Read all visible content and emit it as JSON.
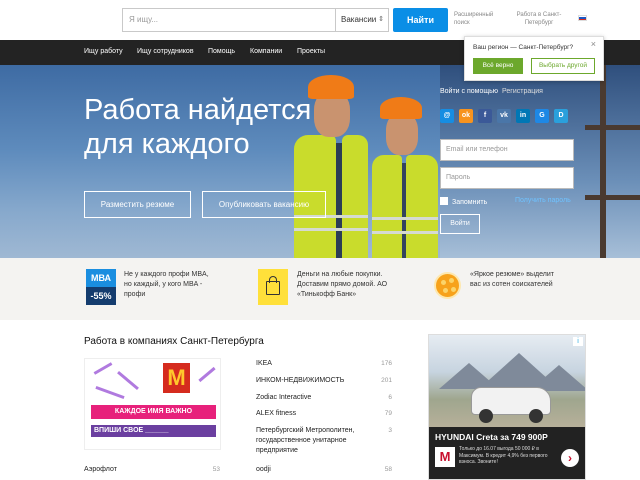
{
  "search": {
    "placeholder": "Я ищу...",
    "select_value": "Вакансии",
    "button": "Найти",
    "advanced": "Расширенный поиск"
  },
  "region_top": "Работа в Санкт-Петербург",
  "nav": [
    "Ищу работу",
    "Ищу сотрудников",
    "Помощь",
    "Компании",
    "Проекты"
  ],
  "region_popup": {
    "message": "Ваш регион — Санкт-Петербург?",
    "confirm": "Всё верно",
    "other": "Выбрать другой",
    "close": "×"
  },
  "hero": {
    "title_line1": "Работа найдется",
    "title_line2": "для каждого",
    "btn_resume": "Разместить резюме",
    "btn_vacancy": "Опубликовать вакансию"
  },
  "login": {
    "tab_social": "Войти с помощью",
    "tab_register": "Регистрация",
    "social_icons": [
      {
        "name": "mail-icon",
        "glyph": "@",
        "color": "#168de2"
      },
      {
        "name": "odnoklassniki-icon",
        "glyph": "ok",
        "color": "#f7931e"
      },
      {
        "name": "facebook-icon",
        "glyph": "f",
        "color": "#3b5998"
      },
      {
        "name": "vk-icon",
        "glyph": "vk",
        "color": "#4a76a8"
      },
      {
        "name": "linkedin-icon",
        "glyph": "in",
        "color": "#0077b5"
      },
      {
        "name": "google-icon",
        "glyph": "G",
        "color": "#1e88e5"
      },
      {
        "name": "d-icon",
        "glyph": "D",
        "color": "#2aa0dc"
      }
    ],
    "email_placeholder": "Email или телефон",
    "password_placeholder": "Пароль",
    "remember": "Запомнить",
    "forgot": "Получить пароль",
    "submit": "Войти"
  },
  "promos": [
    {
      "icon_top": "МВА",
      "icon_bottom": "-55%",
      "line1": "Не у каждого профи MBA,",
      "line2": "но каждый, у кого MBA -",
      "line3": "профи"
    },
    {
      "line1": "Деньги на любые покупки.",
      "line2": "Доставим прямо домой. АО",
      "line3": "«Тинькофф Банк»"
    },
    {
      "line1": "«Яркое резюме» выделит",
      "line2": "вас из сотен соискателей"
    }
  ],
  "companies": {
    "title": "Работа в компаниях Санкт-Петербурга",
    "banner": {
      "logo": "M",
      "line1": "КАЖДОЕ ИМЯ ВАЖНО",
      "line2": "ВПИШИ СВОЕ ______"
    },
    "left": [
      {
        "name": "Аэрофлот",
        "count": "53"
      }
    ],
    "right": [
      {
        "name": "IKEA",
        "count": "176"
      },
      {
        "name": "ИНКОМ-НЕДВИЖИМОСТЬ",
        "count": "201"
      },
      {
        "name": "Zodiac Interactive",
        "count": "6"
      },
      {
        "name": "ALEX fitness",
        "count": "79"
      },
      {
        "name": "Петербургский Метрополитен, государственное унитарное предприятие",
        "count": "3"
      },
      {
        "name": "oodji",
        "count": "58"
      }
    ]
  },
  "ad": {
    "title": "HYUNDAI Creta за 749 900Р",
    "logo": "M",
    "small": "Только до 16.07 выгода 50 000 ₽ в Максимум. В кредит 4,9% без первого взноса. Звоните!",
    "arrow": "›",
    "adchoices": "i"
  },
  "colors": {
    "accent": "#0a8ee6",
    "nav_bg": "#232323",
    "green": "#6ca82c",
    "link": "#6fc2ff"
  }
}
